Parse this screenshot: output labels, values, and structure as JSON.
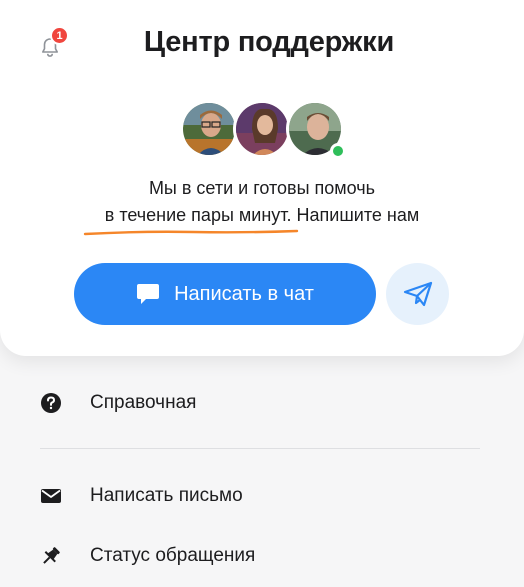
{
  "header": {
    "title": "Центр поддержки",
    "notifications_count": "1"
  },
  "team": {
    "line1": "Мы в сети и готовы помочь",
    "line2_highlight": "в течение пары минут",
    "line2_rest": ". Напишите нам"
  },
  "actions": {
    "chat_label": "Написать в чат",
    "telegram_icon": "paper-plane-icon"
  },
  "menu": {
    "items": [
      {
        "label": "Справочная",
        "icon": "question-circle-icon"
      },
      {
        "label": "Написать письмо",
        "icon": "envelope-icon"
      },
      {
        "label": "Статус обращения",
        "icon": "pin-icon"
      }
    ]
  },
  "colors": {
    "accent": "#2b87f5",
    "badge": "#f0463e",
    "online": "#2fbe5a",
    "underline": "#f5862a"
  }
}
